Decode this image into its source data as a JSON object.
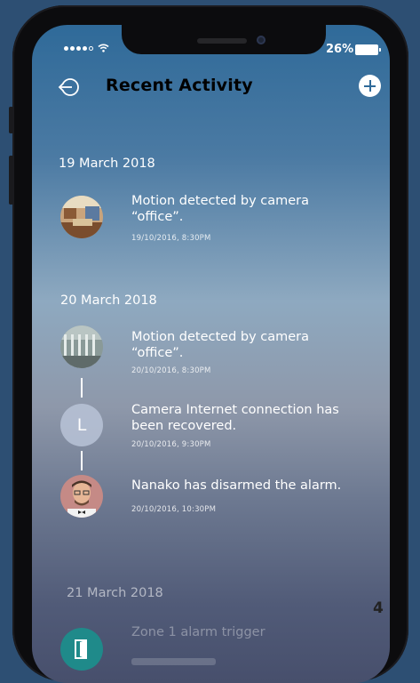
{
  "status_bar": {
    "battery": "26%"
  },
  "header": {
    "title": "Recent Activity"
  },
  "groups": [
    {
      "date": "19 March 2018",
      "items": [
        {
          "text_line1": "Motion detected by camera",
          "text_line2": "“office”.",
          "time": "19/10/2016, 8:30PM"
        }
      ]
    },
    {
      "date": "20 March 2018",
      "items": [
        {
          "text_line1": "Motion detected by camera",
          "text_line2": "“office”.",
          "time": "20/10/2016, 8:30PM"
        },
        {
          "avatar_letter": "L",
          "text_line1": "Camera Internet connection has",
          "text_line2": "been recovered.",
          "time": "20/10/2016, 9:30PM"
        },
        {
          "text_line1": "Nanako has disarmed the alarm.",
          "time": "20/10/2016, 10:30PM"
        }
      ]
    },
    {
      "date": "21 March 2018",
      "items": [
        {
          "text_line1": "Zone 1 alarm trigger"
        }
      ]
    }
  ],
  "page_number": "4"
}
